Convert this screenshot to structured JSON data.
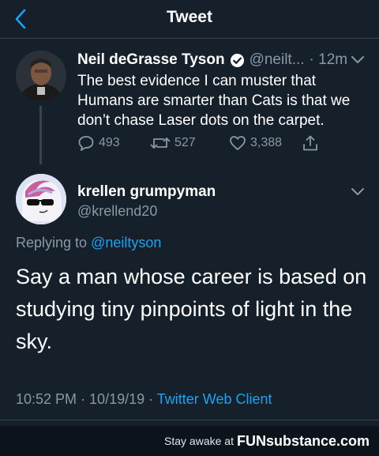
{
  "header": {
    "title": "Tweet"
  },
  "tweet1": {
    "name": "Neil deGrasse Tyson",
    "handle": "@neilt...",
    "time": "· 12m",
    "text": "The best evidence I can muster that Humans are smarter than Cats is that we don’t chase Laser dots on the carpet.",
    "replies": "493",
    "retweets": "527",
    "likes": "3,388"
  },
  "tweet2": {
    "name": "krellen grumpyman",
    "handle": "@krellend20",
    "replying_prefix": "Replying to ",
    "replying_to": "@neiltyson",
    "text": "Say a man whose career is based on studying tiny pinpoints of light in the sky.",
    "timestamp": "10:52 PM · 10/19/19 · ",
    "client": "Twitter Web Client"
  },
  "footer": {
    "prefix": "Stay awake at",
    "brand": "FUNsubstance.com"
  },
  "colors": {
    "background": "#15202b",
    "accent": "#1da1f2",
    "muted": "#8899a6"
  },
  "icons": [
    "back-arrow-icon",
    "verified-icon",
    "chevron-down-icon",
    "reply-icon",
    "retweet-icon",
    "like-icon",
    "share-icon"
  ]
}
